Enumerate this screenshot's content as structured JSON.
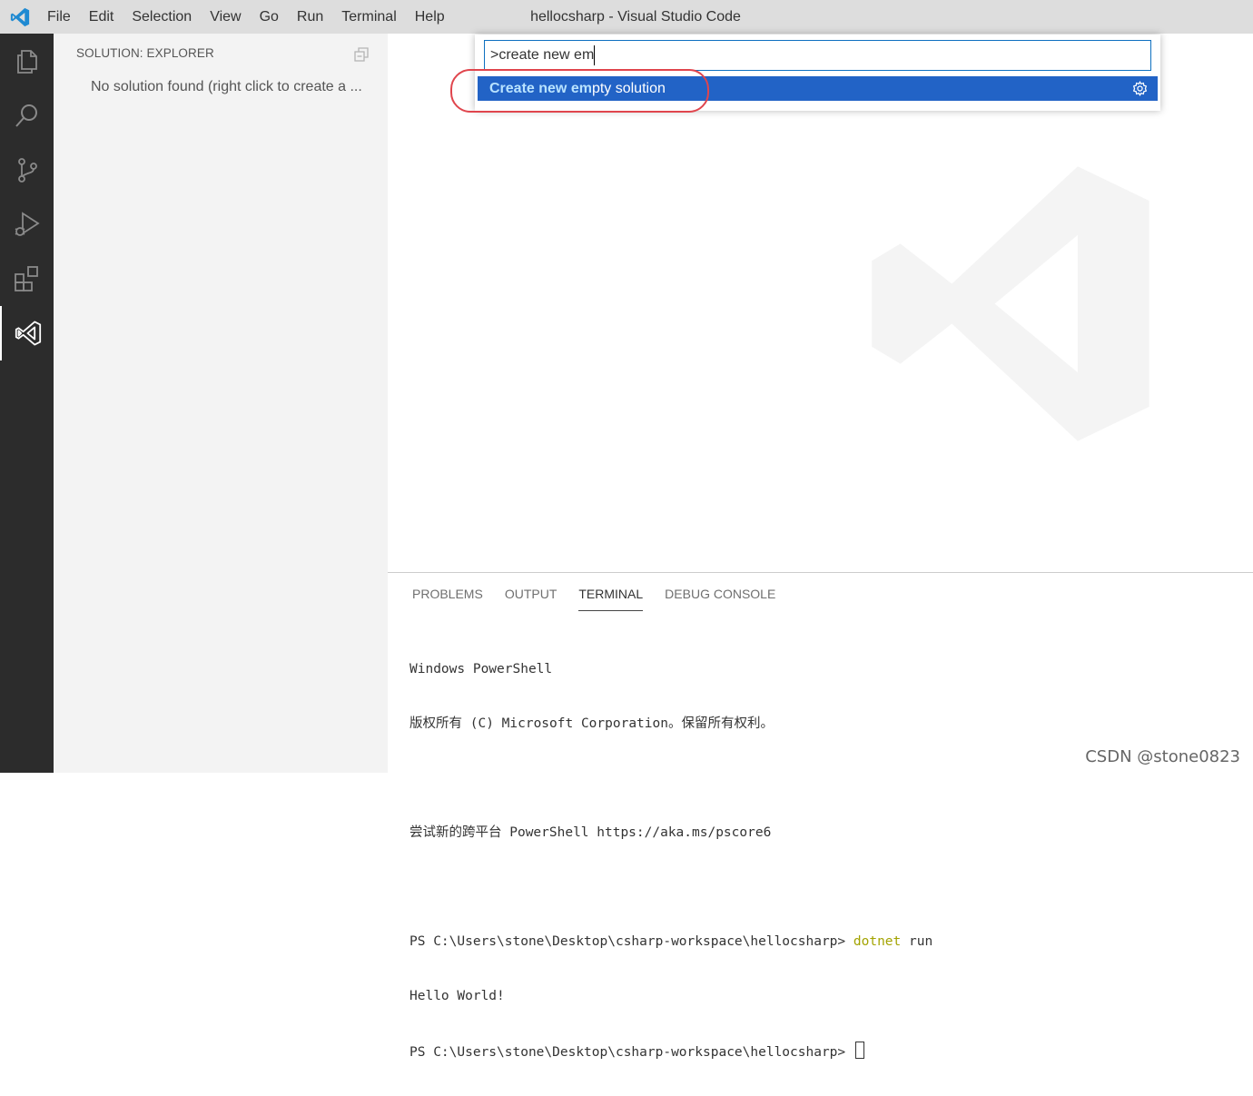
{
  "titlebar": {
    "window_title": "hellocsharp - Visual Studio Code",
    "menu": [
      "File",
      "Edit",
      "Selection",
      "View",
      "Go",
      "Run",
      "Terminal",
      "Help"
    ]
  },
  "activity_bar": {
    "items": [
      {
        "name": "explorer-icon",
        "active": false
      },
      {
        "name": "search-icon",
        "active": false
      },
      {
        "name": "source-control-icon",
        "active": false
      },
      {
        "name": "run-debug-icon",
        "active": false
      },
      {
        "name": "extensions-icon",
        "active": false
      },
      {
        "name": "solution-explorer-icon",
        "active": true
      }
    ]
  },
  "sidebar": {
    "title": "SOLUTION: EXPLORER",
    "empty_message": "No solution found (right click to create a ..."
  },
  "command_palette": {
    "input_value": ">create new em",
    "result": {
      "match_highlight": "Create new em",
      "rest": "pty solution",
      "full_label": "Create new empty solution"
    }
  },
  "panel": {
    "tabs": [
      "PROBLEMS",
      "OUTPUT",
      "TERMINAL",
      "DEBUG CONSOLE"
    ],
    "active_tab": "TERMINAL",
    "terminal": {
      "line1": "Windows PowerShell",
      "line2": "版权所有 (C) Microsoft Corporation。保留所有权利。",
      "line3": "",
      "line4": "尝试新的跨平台 PowerShell https://aka.ms/pscore6",
      "line5": "",
      "prompt1": "PS C:\\Users\\stone\\Desktop\\csharp-workspace\\hellocsharp> ",
      "command1_name": "dotnet",
      "command1_args": " run",
      "output1": "Hello World!",
      "prompt2": "PS C:\\Users\\stone\\Desktop\\csharp-workspace\\hellocsharp> "
    }
  },
  "watermark_text": "CSDN @stone0823",
  "colors": {
    "accent": "#2263c6",
    "activity_bar": "#2c2c2c",
    "sidebar": "#f3f3f3",
    "titlebar": "#dddddd",
    "highlight_oval": "#e0454d",
    "command_color": "#a3a300"
  }
}
